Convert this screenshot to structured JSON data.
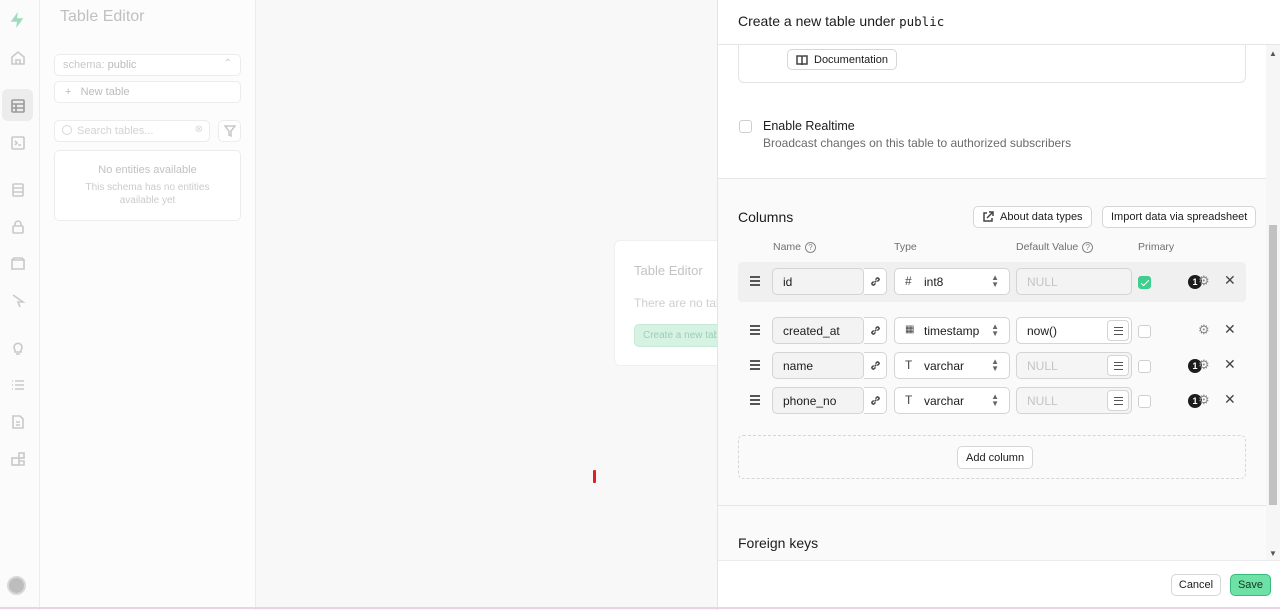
{
  "sidebar": {
    "title": "Table Editor",
    "schema_prefix": "schema:",
    "schema_value": "public",
    "new_table_label": "New table",
    "search_placeholder": "Search tables...",
    "empty_title": "No entities available",
    "empty_desc": "This schema has no entities available yet"
  },
  "main": {
    "title": "Table Editor",
    "subtitle": "There are no tables",
    "create_button": "Create a new table"
  },
  "panel": {
    "title": "Create a new table under",
    "schema": "public",
    "documentation_label": "Documentation",
    "realtime_title": "Enable Realtime",
    "realtime_desc": "Broadcast changes on this table to authorized subscribers",
    "columns_title": "Columns",
    "about_types_label": "About data types",
    "import_label": "Import data via spreadsheet",
    "headers": {
      "name": "Name",
      "type": "Type",
      "default": "Default Value",
      "primary": "Primary"
    },
    "columns": [
      {
        "name": "id",
        "type": "int8",
        "type_icon": "#",
        "default": "NULL",
        "default_placeholder": true,
        "primary": true,
        "badge": "1"
      },
      {
        "name": "created_at",
        "type": "timestamp",
        "type_icon": "calendar",
        "default": "now()",
        "default_placeholder": false,
        "primary": false,
        "badge": ""
      },
      {
        "name": "name",
        "type": "varchar",
        "type_icon": "T",
        "default": "NULL",
        "default_placeholder": true,
        "primary": false,
        "badge": "1"
      },
      {
        "name": "phone_no",
        "type": "varchar",
        "type_icon": "T",
        "default": "NULL",
        "default_placeholder": true,
        "primary": false,
        "badge": "1"
      }
    ],
    "add_column_label": "Add column",
    "foreign_keys_title": "Foreign keys",
    "cancel_label": "Cancel",
    "save_label": "Save"
  },
  "colors": {
    "accent": "#3ecf8e",
    "save_bg": "#6ee1a6"
  }
}
